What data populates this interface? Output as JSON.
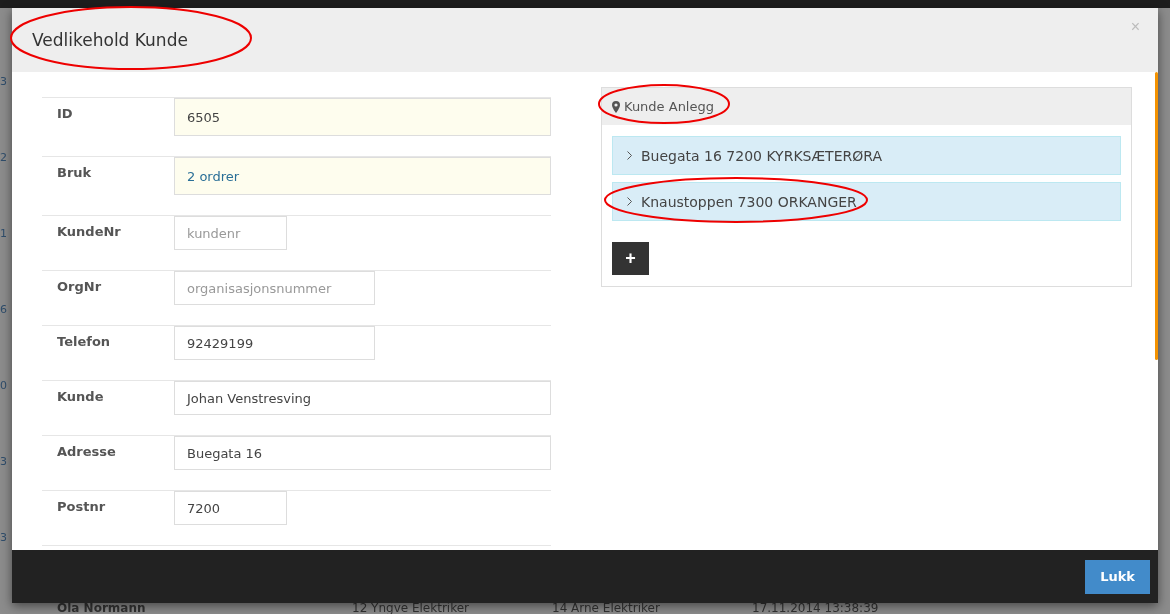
{
  "background": {
    "row_fragments": [
      "3",
      "2",
      "1",
      "6",
      "0",
      "3",
      "3"
    ],
    "last_row": [
      "Ola Normann",
      "12 Yngve Elektriker",
      "14 Arne Elektriker",
      "17.11.2014 13:38:39"
    ]
  },
  "dialog": {
    "title": "Vedlikehold Kunde",
    "title_circled": true,
    "close": "×",
    "fields": [
      {
        "label": "ID",
        "kind": "readonly",
        "value": "6505"
      },
      {
        "label": "Bruk",
        "kind": "link",
        "value": "2 ordrer"
      },
      {
        "label": "KundeNr",
        "kind": "short",
        "placeholder": "kundenr"
      },
      {
        "label": "OrgNr",
        "kind": "medium",
        "placeholder": "organisasjonsnummer"
      },
      {
        "label": "Telefon",
        "kind": "medium",
        "value": "92429199"
      },
      {
        "label": "Kunde",
        "kind": "wide",
        "value": "Johan Venstresving"
      },
      {
        "label": "Adresse",
        "kind": "wide",
        "value": "Buegata 16"
      },
      {
        "label": "Postnr",
        "kind": "short",
        "value": "7200"
      }
    ],
    "panel": {
      "heading": "Kunde Anlegg",
      "heading_circled": true,
      "items": [
        {
          "label": "Buegata 16 7200 KYRKSÆTERØRA",
          "circled": false
        },
        {
          "label": "Knaustoppen 7300 ORKANGER",
          "circled": true
        }
      ],
      "add_button": "+"
    },
    "footer_button": "Lukk"
  }
}
